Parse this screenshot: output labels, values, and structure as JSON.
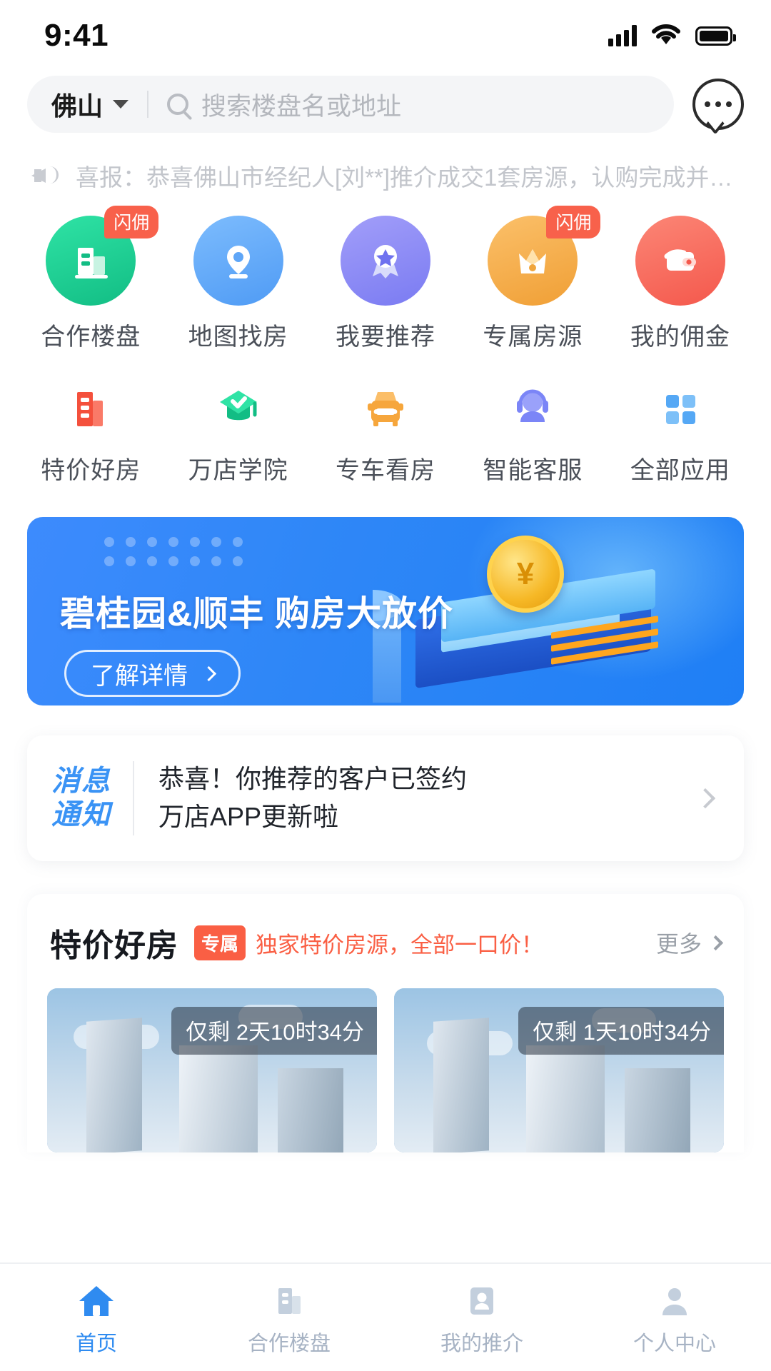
{
  "status_bar": {
    "time": "9:41",
    "signal_icon": "cellular-signal-icon",
    "wifi_icon": "wifi-icon",
    "battery_icon": "battery-icon"
  },
  "search": {
    "city": "佛山",
    "placeholder": "搜索楼盘名或地址",
    "chat_icon": "chat-bubble-icon"
  },
  "announcement": {
    "icon": "megaphone-icon",
    "text": "喜报：恭喜佛山市经纪人[刘**]推介成交1套房源，认购完成并完…"
  },
  "quick_entries": {
    "row1": [
      {
        "label": "合作楼盘",
        "icon": "building-icon",
        "badge": "闪佣",
        "color": "#1fcb8c"
      },
      {
        "label": "地图找房",
        "icon": "map-pin-icon",
        "badge": "",
        "color": "#62a7f8"
      },
      {
        "label": "我要推荐",
        "icon": "medal-star-icon",
        "badge": "",
        "color": "#8a8bf5"
      },
      {
        "label": "专属房源",
        "icon": "crown-icon",
        "badge": "闪佣",
        "color": "#f5ab47"
      },
      {
        "label": "我的佣金",
        "icon": "wallet-icon",
        "badge": "",
        "color": "#f86a5c"
      }
    ],
    "row2": [
      {
        "label": "特价好房",
        "icon": "price-building-icon",
        "color": "#f4503c"
      },
      {
        "label": "万店学院",
        "icon": "graduation-cap-icon",
        "color": "#14ca8f"
      },
      {
        "label": "专车看房",
        "icon": "car-icon",
        "color": "#f6a63c"
      },
      {
        "label": "智能客服",
        "icon": "headset-agent-icon",
        "color": "#7b85f7"
      },
      {
        "label": "全部应用",
        "icon": "grid-apps-icon",
        "color": "#55a8f5"
      }
    ]
  },
  "banner": {
    "title": "碧桂园&顺丰 购房大放价",
    "cta": "了解详情",
    "cta_arrow_icon": "chevron-right-icon",
    "coin_symbol": "¥",
    "accent": "#2f87f7"
  },
  "message_card": {
    "tag_line1": "消息",
    "tag_line2": "通知",
    "line1": "恭喜！你推荐的客户已签约",
    "line2": "万店APP更新啦",
    "chevron_icon": "chevron-right-icon"
  },
  "deals": {
    "title": "特价好房",
    "pill": "专属",
    "subtitle": "独家特价房源，全部一口价！",
    "more": "更多",
    "more_icon": "chevron-right-icon",
    "cards": [
      {
        "countdown": "仅剩 2天10时34分",
        "image": "highrise-buildings-photo"
      },
      {
        "countdown": "仅剩 1天10时34分",
        "image": "highrise-buildings-photo"
      }
    ]
  },
  "tabbar": {
    "active_color": "#2f8bf0",
    "inactive_color": "#a7b3c4",
    "items": [
      {
        "label": "首页",
        "icon": "home-icon",
        "active": true
      },
      {
        "label": "合作楼盘",
        "icon": "building-icon",
        "active": false
      },
      {
        "label": "我的推介",
        "icon": "id-card-icon",
        "active": false
      },
      {
        "label": "个人中心",
        "icon": "person-icon",
        "active": false
      }
    ]
  }
}
